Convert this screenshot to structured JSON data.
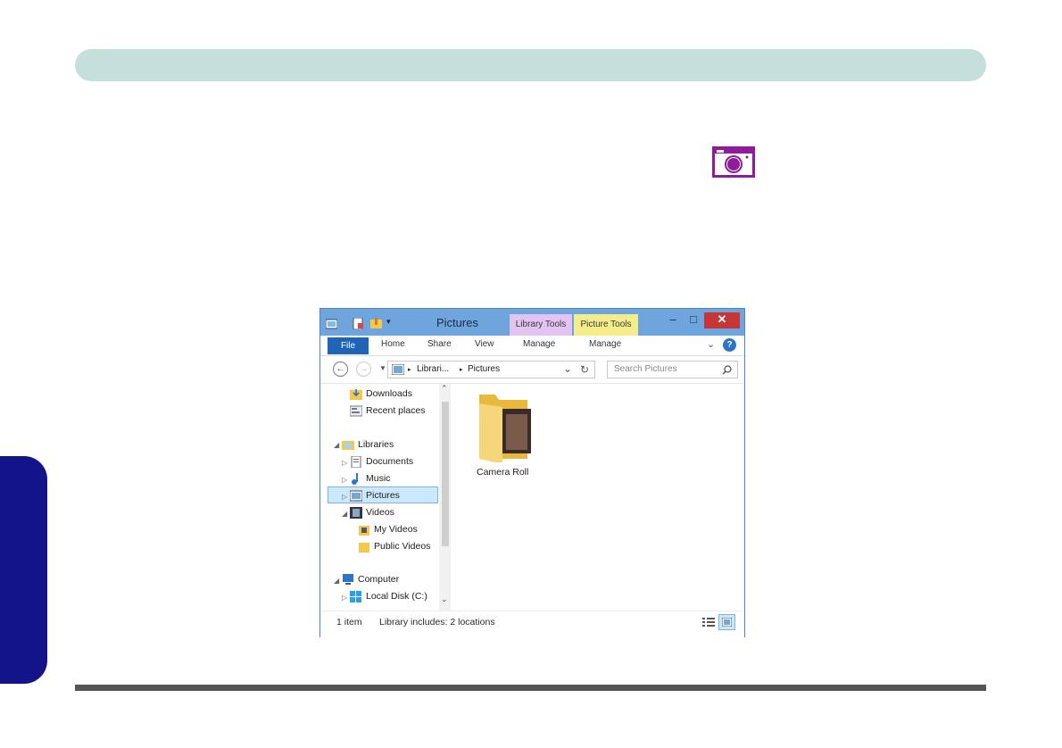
{
  "window": {
    "title": "Pictures",
    "contextual_tabs": [
      "Library Tools",
      "Picture Tools"
    ],
    "controls": {
      "minimize": "–",
      "maximize": "□",
      "close": "✕"
    }
  },
  "ribbon": {
    "file_tab": "File",
    "tabs": [
      "Home",
      "Share",
      "View",
      "Manage",
      "Manage"
    ],
    "collapse_icon": "chevron-down-icon",
    "help_icon": "?"
  },
  "navbar": {
    "breadcrumb": [
      "Librari...",
      "Pictures"
    ],
    "search_placeholder": "Search Pictures"
  },
  "nav_pane": {
    "items": [
      {
        "label": "Downloads",
        "icon": "downloads-folder-icon"
      },
      {
        "label": "Recent places",
        "icon": "recent-places-icon"
      },
      {
        "label": "Libraries",
        "icon": "library-folder-icon"
      },
      {
        "label": "Documents",
        "icon": "documents-icon"
      },
      {
        "label": "Music",
        "icon": "music-icon"
      },
      {
        "label": "Pictures",
        "icon": "pictures-icon",
        "selected": true
      },
      {
        "label": "Videos",
        "icon": "videos-icon"
      },
      {
        "label": "My Videos",
        "icon": "folder-icon"
      },
      {
        "label": "Public Videos",
        "icon": "folder-icon"
      },
      {
        "label": "Computer",
        "icon": "computer-icon"
      },
      {
        "label": "Local Disk (C:)",
        "icon": "local-disk-icon"
      }
    ]
  },
  "content": {
    "items": [
      {
        "label": "Camera Roll",
        "icon": "pictures-folder-icon"
      }
    ]
  },
  "status": {
    "count": "1 item",
    "library": "Library includes: 2 locations"
  },
  "colors": {
    "header_bar": "#c5e0dc",
    "side_tab": "#14148a",
    "camera_icon": "#8f1c9a",
    "window_frame": "#6ea5dd",
    "selection": "#cce8ff"
  }
}
